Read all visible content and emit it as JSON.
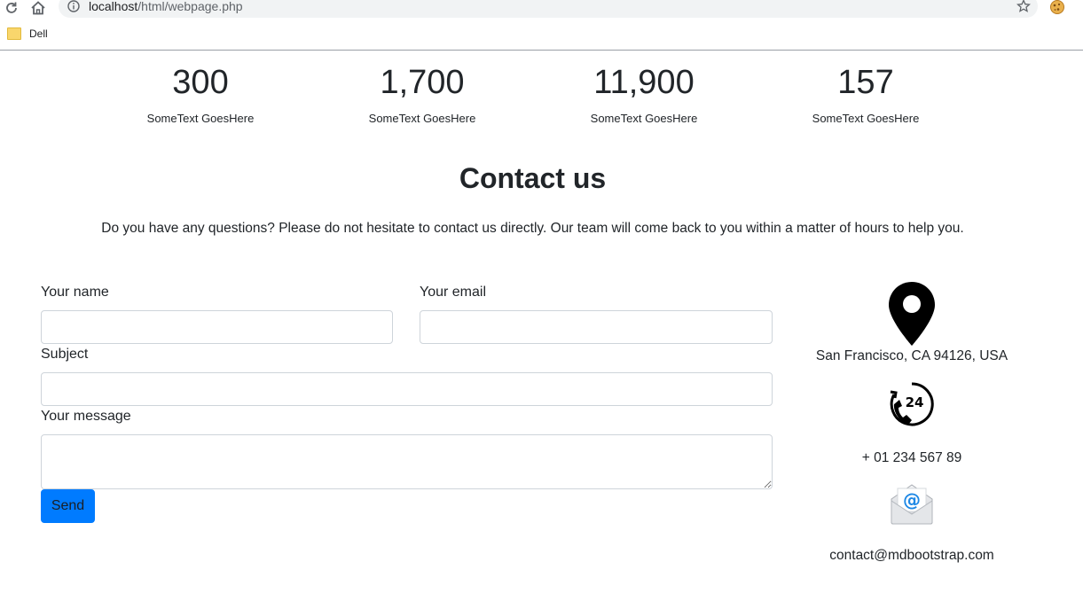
{
  "browser": {
    "url_host": "localhost",
    "url_path": "/html/webpage.php",
    "bookmark_label": "Dell"
  },
  "stats": [
    {
      "value": "300",
      "caption": "SomeText GoesHere"
    },
    {
      "value": "1,700",
      "caption": "SomeText GoesHere"
    },
    {
      "value": "11,900",
      "caption": "SomeText GoesHere"
    },
    {
      "value": "157",
      "caption": "SomeText GoesHere"
    }
  ],
  "contact": {
    "title": "Contact us",
    "description": "Do you have any questions? Please do not hesitate to contact us directly. Our team will come back to you within a matter of hours to help you.",
    "form": {
      "name_label": "Your name",
      "name_value": "",
      "email_label": "Your email",
      "email_value": "",
      "subject_label": "Subject",
      "subject_value": "",
      "message_label": "Your message",
      "message_value": "",
      "send_label": "Send"
    },
    "info": {
      "address": "San Francisco, CA 94126, USA",
      "phone": "+ 01 234 567 89",
      "email": "contact@mdbootstrap.com"
    }
  },
  "icons": {
    "reload": "reload-icon",
    "home": "home-icon",
    "info": "info-icon",
    "star": "star-icon",
    "extension": "cookie-extension-icon",
    "address": "map-pin-icon",
    "phone": "phone-24-icon",
    "email": "email-envelope-icon"
  }
}
